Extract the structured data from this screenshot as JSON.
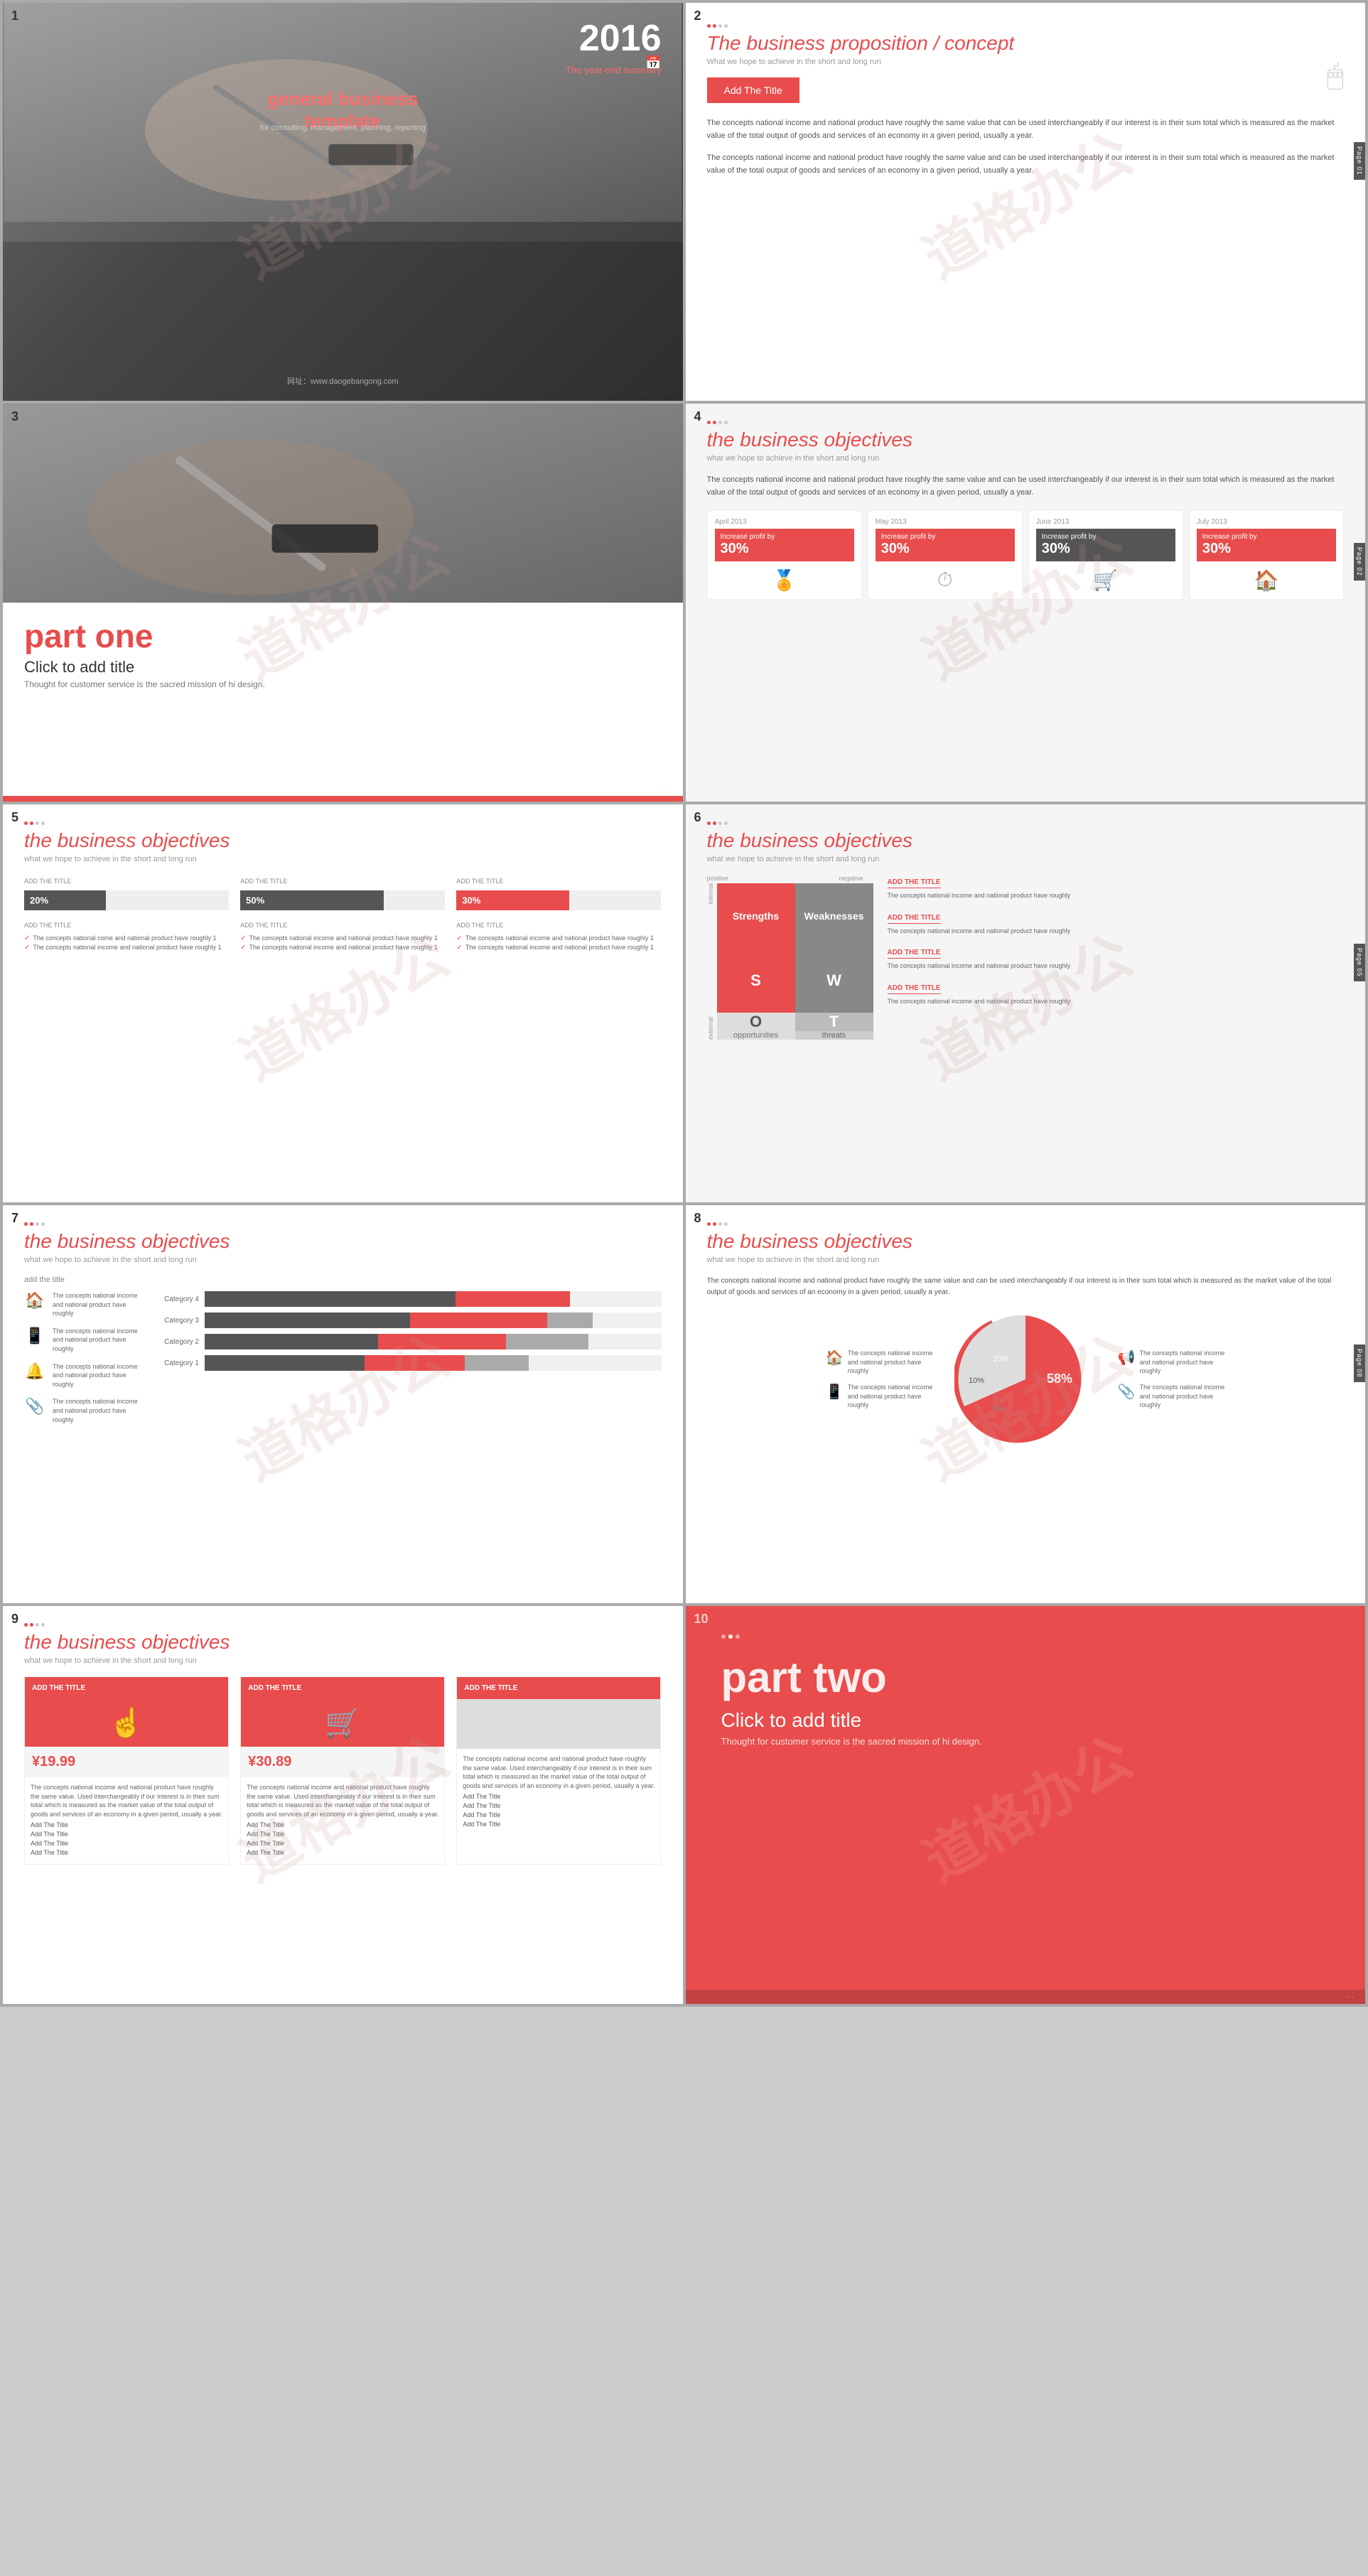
{
  "slides": [
    {
      "number": "1",
      "year": "2016",
      "subtitle": "The year-end summary",
      "main_title": "general business template",
      "for_text": "for consulting, management, planning, reporting",
      "url": "网址：www.daogebangong.com",
      "watermark": "道格办公"
    },
    {
      "number": "2",
      "title": "The business proposition / concept",
      "subtitle": "What we hope to achieve in the short and long run",
      "btn_label": "Add The Title",
      "body1": "The concepts national income and national product have roughly the same value that can be used interchangeably if our interest is in their sum total which is measured as the market value of the total output of goods and services of an economy in a given period, usually a year.",
      "body2": "The concepts national income and national product have roughly the same value and can be used interchangeably if our interest is in their sum total which is measured as the market value of the total output of goods and services of an economy in a given period, usually a year.",
      "side_tab": "Page 01",
      "watermark": "道格办公"
    },
    {
      "number": "3",
      "part_label": "part one",
      "click_title": "Click to add title",
      "click_sub": "Thought for customer service is the sacred mission of hi design.",
      "watermark": "道格办公"
    },
    {
      "number": "4",
      "title": "the business objectives",
      "subtitle": "what we hope to achieve in the short and long run",
      "body": "The concepts national income and national product have roughly the same value and can be used interchangeably if our interest is in their sum total which is measured as the market value of the total output of goods and services of an economy in a given period, usually a year.",
      "months": [
        {
          "label": "April 2013",
          "text": "Increase profit by",
          "percent": "30%",
          "icon": "🏅"
        },
        {
          "label": "May 2013",
          "text": "Increase profit by",
          "percent": "30%",
          "icon": "⏱"
        },
        {
          "label": "June 2013",
          "text": "Incre... profit by",
          "percent": "30%",
          "icon": "🛒",
          "dark": true
        },
        {
          "label": "July 2013",
          "text": "Increase profit by",
          "percent": "30%",
          "icon": "🏠"
        }
      ],
      "side_tab": "Page 02",
      "watermark": "道格办公"
    },
    {
      "number": "5",
      "title": "the business objectives",
      "subtitle": "what we hope to achieve in the short and long run",
      "cols": [
        {
          "label": "ADD THE TITLE",
          "percent": "20%",
          "bar_type": "dark",
          "width": 40,
          "bullet1": "The concepts national come and national product have roughly 1",
          "bullet2": "The concepts national income and national product have roughly 1"
        },
        {
          "label": "ADD THE TITLE",
          "percent": "50%",
          "bar_type": "dark",
          "width": 70,
          "bullet1": "The concepts national income and national product have roughly 1",
          "bullet2": "The concepts national income and national product have roughly 1"
        },
        {
          "label": "ADD THE TITLE",
          "percent": "30%",
          "bar_type": "red",
          "width": 55,
          "bullet1": "The concepts national income and national product have roughly 1",
          "bullet2": "The concepts national income and national product have roughly 1"
        }
      ],
      "watermark": "道格办公"
    },
    {
      "number": "6",
      "title": "the business objectives",
      "subtitle": "what we hope to achieve in the short and long run",
      "swot": {
        "s_label": "Strengths",
        "w_label": "Weaknesses",
        "o_label": "opportunities",
        "t_label": "threats",
        "internal": "internal",
        "external": "external",
        "positive": "positive",
        "negative": "negative"
      },
      "items": [
        {
          "title": "ADD THE TITLE",
          "text": "The concepts national income and national product have roughly"
        },
        {
          "title": "ADD THE TITLE",
          "text": "The concepts national income and national product have roughly"
        },
        {
          "title": "ADD THE TITLE",
          "text": "The concepts national income and national product have roughly"
        },
        {
          "title": "ADD THE TITLE",
          "text": "The concepts national income and national product have roughly"
        }
      ],
      "side_tab": "Page 05",
      "watermark": "道格办公"
    },
    {
      "number": "7",
      "title": "the business objectives",
      "subtitle": "what we hope to achieve in the short and long run",
      "add_title": "add the title",
      "icon_items": [
        {
          "icon": "🏠",
          "text": "The concepts national income and national product have roughly"
        },
        {
          "icon": "📱",
          "text": "The concepts national income and national product have roughly"
        },
        {
          "icon": "🔔",
          "text": "The concepts national income and national product have roughly"
        },
        {
          "icon": "📎",
          "text": "The concepts national income and national product have roughly"
        }
      ],
      "bars": [
        {
          "label": "Category 4",
          "dark": 60,
          "red": 25,
          "light": 0
        },
        {
          "label": "Category 3",
          "dark": 50,
          "red": 35,
          "light": 10
        },
        {
          "label": "Category 2",
          "dark": 45,
          "red": 30,
          "light": 20
        },
        {
          "label": "Category 1",
          "dark": 40,
          "red": 25,
          "light": 15
        }
      ],
      "watermark": "道格办公"
    },
    {
      "number": "8",
      "title": "the business objectives",
      "subtitle": "what we hope to achieve in the short and long run",
      "body": "The concepts national income and national product have roughly the same value and can be used interchangeably if our interest is in their sum total which is measured as the market value of the total output of goods and services of an economy in a given period, usually a year.",
      "pie_segments": [
        {
          "label": "58%",
          "value": 58,
          "color": "#e84c4c"
        },
        {
          "label": "23%",
          "value": 23,
          "color": "#888"
        },
        {
          "label": "10%",
          "value": 10,
          "color": "#bbb"
        },
        {
          "label": "9%",
          "value": 9,
          "color": "#ddd"
        }
      ],
      "left_items": [
        {
          "icon": "🏠",
          "text": "The concepts national income and national product have roughly"
        },
        {
          "icon": "📱",
          "text": "The concepts national income and national product have roughly"
        }
      ],
      "right_items": [
        {
          "icon": "📢",
          "text": "The concepts national income and national product have roughly"
        },
        {
          "icon": "📎",
          "text": "The concepts national income and national product have roughly"
        }
      ],
      "side_tab": "Page 08",
      "watermark": "道格办公"
    },
    {
      "number": "9",
      "title": "the business objectives",
      "subtitle": "what we hope to achieve in the short and long run",
      "cards": [
        {
          "header": "ADD THE TITLE",
          "price": "¥19.99",
          "icon": "👆",
          "body": "The concepts national income and national product have roughly the same value. Used interchangeably if our interest is in their sum total which is measured as the market value of the total output of goods and services of an economy in a given period, usually a year.",
          "items": [
            "Add The Title",
            "Add The Title",
            "Add The Title",
            "Add The Title"
          ]
        },
        {
          "header": "ADD THE TITLE",
          "price": "¥30.89",
          "icon": "🛒",
          "body": "The concepts national income and national product have roughly the same value. Used interchangeably if our interest is in their sum total which is measured as the market value of the total output of goods and services of an economy in a given period, usually a year.",
          "items": [
            "Add The Title",
            "Add The Title",
            "Add The Title",
            "Add The Title"
          ]
        },
        {
          "header": "ADD THE TITLE",
          "price": "",
          "icon": "",
          "body": "The concepts national income and national product have roughly the same value. Used interchangeably if our interest is in their sum total which is measured as the market value of the total output of goods and services of an economy in a given period, usually a year.",
          "items": [
            "Add The Title",
            "Add The Title",
            "Add The Title",
            "Add The Title"
          ]
        }
      ],
      "watermark": "道格办公"
    },
    {
      "number": "10",
      "part_label": "part two",
      "click_title": "Click to add title",
      "click_sub": "Thought for customer service is the sacred mission of hi design.",
      "watermark": "道格办公"
    }
  ]
}
